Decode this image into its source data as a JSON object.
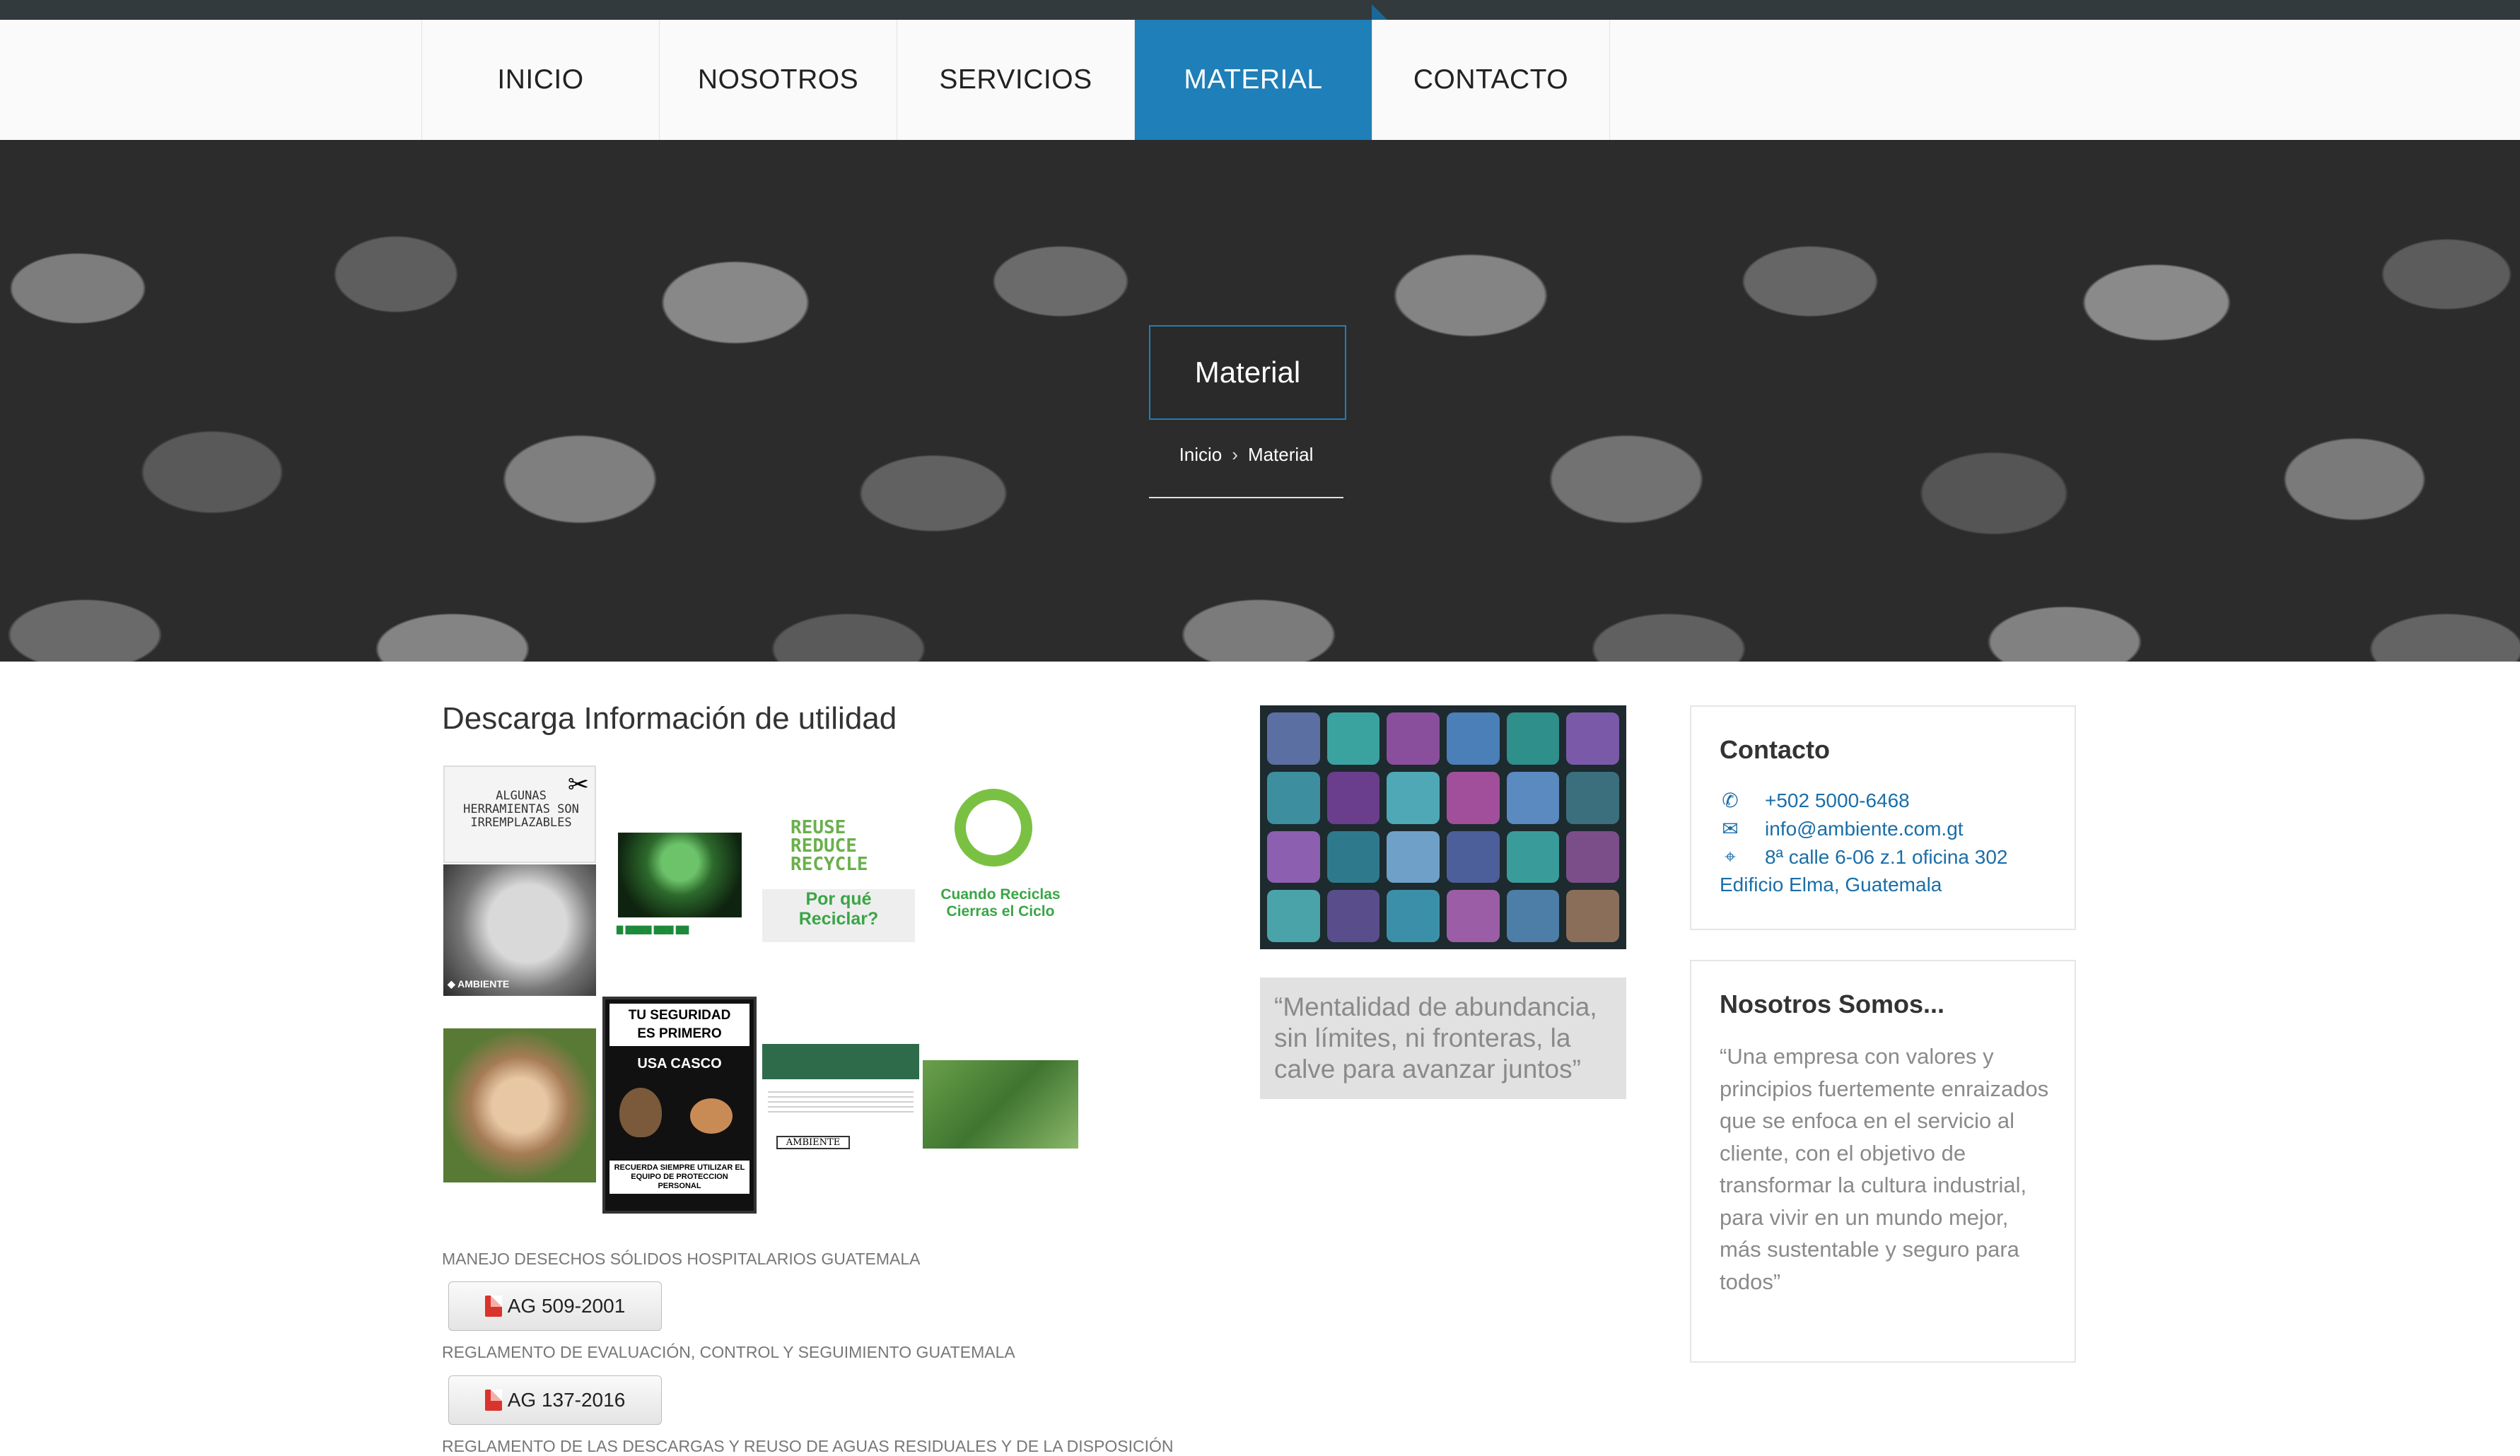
{
  "nav": {
    "items": [
      {
        "label": "INICIO"
      },
      {
        "label": "NOSOTROS"
      },
      {
        "label": "SERVICIOS"
      },
      {
        "label": "MATERIAL"
      },
      {
        "label": "CONTACTO"
      }
    ],
    "active": "MATERIAL"
  },
  "hero": {
    "title": "Material",
    "breadcrumb": [
      "Inicio",
      "Material"
    ]
  },
  "main": {
    "title": "Descarga Información de utilidad",
    "thumbnails": {
      "t1": {
        "line1": "ALGUNAS",
        "line2": "HERRAMIENTAS SON",
        "line3": "IRREMPLAZABLES"
      },
      "t3": {
        "line1": "Por qué",
        "line2": "Reciclar?"
      },
      "t4": {
        "line1": "Cuando Reciclas",
        "line2": "Cierras el Ciclo"
      },
      "t6": {
        "line1": "TU SEGURIDAD",
        "line2": "ES PRIMERO",
        "line3": "USA CASCO",
        "line4": "RECUERDA SIEMPRE UTILIZAR EL EQUIPO DE PROTECCION PERSONAL"
      },
      "t7": {
        "brand": "AMBIENTE"
      },
      "recycle_words": [
        "RE",
        "USE",
        "RE",
        "DUCE",
        "RE",
        "CYCLE"
      ]
    },
    "documents": [
      {
        "label": "MANEJO DESECHOS SÓLIDOS HOSPITALARIOS GUATEMALA",
        "button": "AG 509-2001"
      },
      {
        "label": "REGLAMENTO DE EVALUACIÓN, CONTROL Y SEGUIMIENTO GUATEMALA",
        "button": "AG 137-2016"
      },
      {
        "label": "REGLAMENTO DE LAS DESCARGAS Y REUSO DE AGUAS RESIDUALES Y DE LA DISPOSICIÓN"
      }
    ]
  },
  "middle": {
    "quote": "“Mentalidad de abundancia, sin límites, ni fronteras, la calve para avanzar juntos”"
  },
  "sidebar": {
    "contact": {
      "title": "Contacto",
      "phone": "+502 5000-6468",
      "email": "info@ambiente.com.gt",
      "address1": "8ª calle 6-06 z.1 oficina 302",
      "address2": "Edificio Elma, Guatemala"
    },
    "about": {
      "title": "Nosotros Somos...",
      "text": "“Una empresa con valores y principios fuertemente enraizados que se enfoca en el servicio al cliente, con el objetivo de transformar la cultura industrial, para vivir en un mundo mejor, más sustentable y seguro para todos”"
    }
  },
  "colors": {
    "accent": "#1f7fb8",
    "topbar": "#333a3d",
    "link": "#1a6ea8",
    "muted": "#8a8a8a"
  },
  "icons": [
    "phone-icon",
    "envelope-icon",
    "map-icon",
    "pdf-icon"
  ]
}
